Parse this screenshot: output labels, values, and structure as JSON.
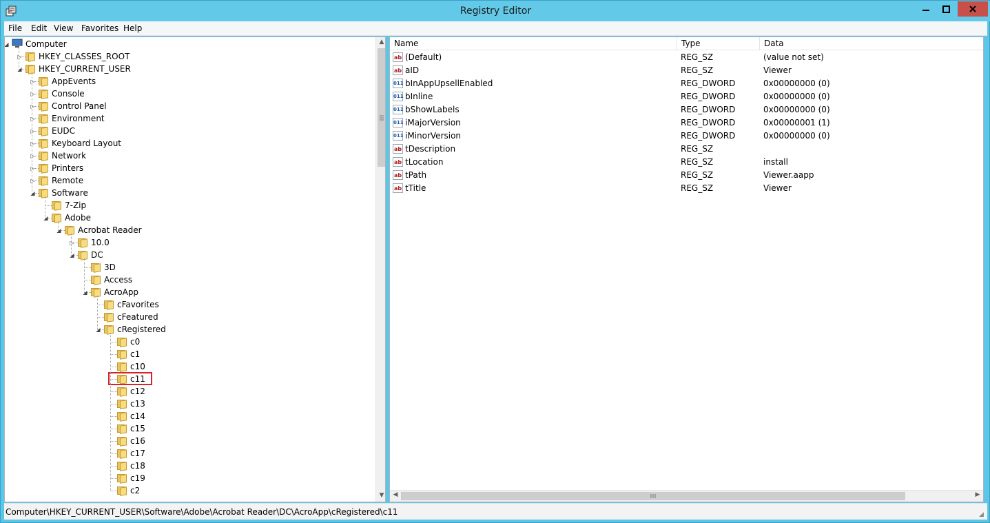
{
  "window": {
    "title": "Registry Editor"
  },
  "menu": [
    "File",
    "Edit",
    "View",
    "Favorites",
    "Help"
  ],
  "tree": [
    {
      "label": "Computer",
      "depth": 0,
      "exp": "open"
    },
    {
      "label": "HKEY_CLASSES_ROOT",
      "depth": 1,
      "exp": "closed"
    },
    {
      "label": "HKEY_CURRENT_USER",
      "depth": 1,
      "exp": "open"
    },
    {
      "label": "AppEvents",
      "depth": 2,
      "exp": "closed"
    },
    {
      "label": "Console",
      "depth": 2,
      "exp": "closed"
    },
    {
      "label": "Control Panel",
      "depth": 2,
      "exp": "closed"
    },
    {
      "label": "Environment",
      "depth": 2,
      "exp": "closed"
    },
    {
      "label": "EUDC",
      "depth": 2,
      "exp": "closed"
    },
    {
      "label": "Keyboard Layout",
      "depth": 2,
      "exp": "closed"
    },
    {
      "label": "Network",
      "depth": 2,
      "exp": "closed"
    },
    {
      "label": "Printers",
      "depth": 2,
      "exp": "closed"
    },
    {
      "label": "Remote",
      "depth": 2,
      "exp": "closed"
    },
    {
      "label": "Software",
      "depth": 2,
      "exp": "open"
    },
    {
      "label": "7-Zip",
      "depth": 3,
      "exp": "none"
    },
    {
      "label": "Adobe",
      "depth": 3,
      "exp": "open"
    },
    {
      "label": "Acrobat Reader",
      "depth": 4,
      "exp": "open"
    },
    {
      "label": "10.0",
      "depth": 5,
      "exp": "closed"
    },
    {
      "label": "DC",
      "depth": 5,
      "exp": "open"
    },
    {
      "label": "3D",
      "depth": 6,
      "exp": "none"
    },
    {
      "label": "Access",
      "depth": 6,
      "exp": "none"
    },
    {
      "label": "AcroApp",
      "depth": 6,
      "exp": "open"
    },
    {
      "label": "cFavorites",
      "depth": 7,
      "exp": "none"
    },
    {
      "label": "cFeatured",
      "depth": 7,
      "exp": "none"
    },
    {
      "label": "cRegistered",
      "depth": 7,
      "exp": "open"
    },
    {
      "label": "c0",
      "depth": 8,
      "exp": "none"
    },
    {
      "label": "c1",
      "depth": 8,
      "exp": "none"
    },
    {
      "label": "c10",
      "depth": 8,
      "exp": "none"
    },
    {
      "label": "c11",
      "depth": 8,
      "exp": "none",
      "selected": true
    },
    {
      "label": "c12",
      "depth": 8,
      "exp": "none"
    },
    {
      "label": "c13",
      "depth": 8,
      "exp": "none"
    },
    {
      "label": "c14",
      "depth": 8,
      "exp": "none"
    },
    {
      "label": "c15",
      "depth": 8,
      "exp": "none"
    },
    {
      "label": "c16",
      "depth": 8,
      "exp": "none"
    },
    {
      "label": "c17",
      "depth": 8,
      "exp": "none"
    },
    {
      "label": "c18",
      "depth": 8,
      "exp": "none"
    },
    {
      "label": "c19",
      "depth": 8,
      "exp": "none"
    },
    {
      "label": "c2",
      "depth": 8,
      "exp": "none"
    }
  ],
  "columns": {
    "name": "Name",
    "type": "Type",
    "data": "Data"
  },
  "values": [
    {
      "icon": "ab",
      "name": "(Default)",
      "type": "REG_SZ",
      "data": "(value not set)"
    },
    {
      "icon": "ab",
      "name": "aID",
      "type": "REG_SZ",
      "data": "Viewer"
    },
    {
      "icon": "bin",
      "name": "bInAppUpsellEnabled",
      "type": "REG_DWORD",
      "data": "0x00000000 (0)"
    },
    {
      "icon": "bin",
      "name": "bInline",
      "type": "REG_DWORD",
      "data": "0x00000000 (0)"
    },
    {
      "icon": "bin",
      "name": "bShowLabels",
      "type": "REG_DWORD",
      "data": "0x00000000 (0)"
    },
    {
      "icon": "bin",
      "name": "iMajorVersion",
      "type": "REG_DWORD",
      "data": "0x00000001 (1)"
    },
    {
      "icon": "bin",
      "name": "iMinorVersion",
      "type": "REG_DWORD",
      "data": "0x00000000 (0)"
    },
    {
      "icon": "ab",
      "name": "tDescription",
      "type": "REG_SZ",
      "data": ""
    },
    {
      "icon": "ab",
      "name": "tLocation",
      "type": "REG_SZ",
      "data": "install"
    },
    {
      "icon": "ab",
      "name": "tPath",
      "type": "REG_SZ",
      "data": "Viewer.aapp"
    },
    {
      "icon": "ab",
      "name": "tTitle",
      "type": "REG_SZ",
      "data": "Viewer"
    }
  ],
  "status": {
    "path": "Computer\\HKEY_CURRENT_USER\\Software\\Adobe\\Acrobat Reader\\DC\\AcroApp\\cRegistered\\c11"
  }
}
